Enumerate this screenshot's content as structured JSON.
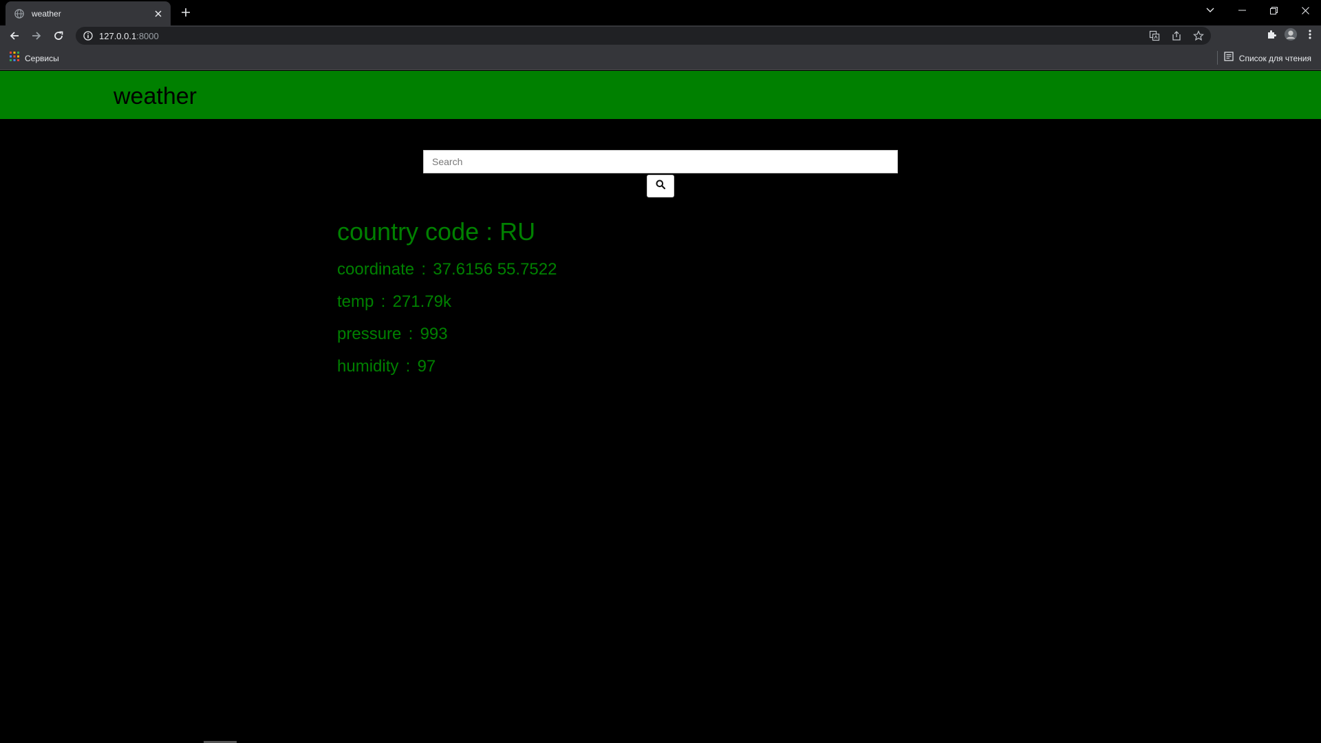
{
  "browser": {
    "tab_title": "weather",
    "url_host": "127.0.0.1",
    "url_port": ":8000",
    "bookmarks": {
      "apps_label": "Сервисы",
      "reading_list_label": "Список для чтения"
    }
  },
  "header": {
    "brand": "weather",
    "color": "#008000"
  },
  "search": {
    "placeholder": "Search",
    "value": ""
  },
  "results": {
    "country_label": "country code",
    "country_value": "RU",
    "coordinate_label": "coordinate",
    "coordinate_value": "37.6156 55.7522",
    "temp_label": "temp",
    "temp_value": "271.79k",
    "pressure_label": "pressure",
    "pressure_value": "993",
    "humidity_label": "humidity",
    "humidity_value": "97",
    "text_color": "#008000"
  }
}
